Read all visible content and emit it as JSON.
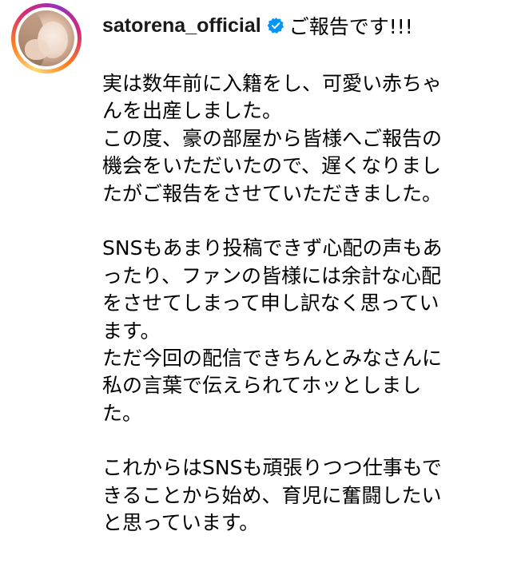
{
  "post": {
    "username": "satorena_official",
    "verified": true,
    "headline": "ご報告です!!!",
    "caption_paragraphs": [
      {
        "lines": [
          "実は数年前に入籍をし、可愛い赤ちゃ",
          "んを出産しました。",
          "この度、豪の部屋から皆様へご報告の",
          "機会をいただいたので、遅くなりまし",
          "たがご報告をさせていただきました。"
        ]
      },
      {
        "lines": [
          "SNSもあまり投稿できず心配の声もあ",
          "ったり、ファンの皆様には余計な心配",
          "をさせてしまって申し訳なく思ってい",
          "ます。",
          "ただ今回の配信できちんとみなさんに",
          "私の言葉で伝えられてホッとしまし",
          "た。"
        ]
      },
      {
        "lines": [
          "これからはSNSも頑張りつつ仕事もで",
          "きることから始め、育児に奮闘したい",
          "と思っています。"
        ]
      }
    ]
  },
  "icons": {
    "verified": "verified-badge-icon",
    "avatar": "profile-photo"
  },
  "colors": {
    "verified_blue": "#0095f6",
    "ring_gradient": [
      "#feda75",
      "#fa7e1e",
      "#d62976",
      "#962fbf"
    ]
  }
}
